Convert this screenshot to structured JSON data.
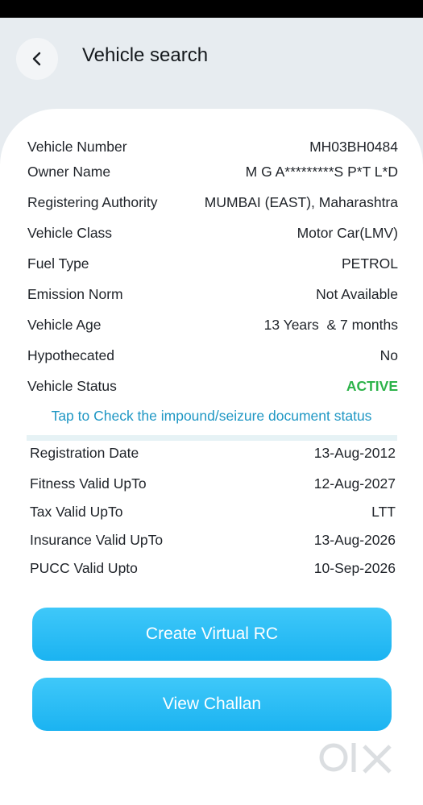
{
  "header": {
    "title": "Vehicle search"
  },
  "details": [
    {
      "label": "Vehicle Number",
      "value": "MH03BH0484"
    },
    {
      "label": "Owner Name",
      "value": "M G A*********S P*T L*D"
    },
    {
      "label": "Registering Authority",
      "value": "MUMBAI (EAST), Maharashtra"
    },
    {
      "label": "Vehicle Class",
      "value": "Motor Car(LMV)"
    },
    {
      "label": "Fuel Type",
      "value": "PETROL"
    },
    {
      "label": "Emission Norm",
      "value": "Not Available"
    },
    {
      "label": "Vehicle Age",
      "value": "13 Years  & 7 months"
    },
    {
      "label": "Hypothecated",
      "value": "No"
    },
    {
      "label": "Vehicle Status",
      "value": "ACTIVE"
    }
  ],
  "impound_link": "Tap to Check the impound/seizure document status",
  "validity": [
    {
      "label": "Registration Date",
      "value": "13-Aug-2012"
    },
    {
      "label": "Fitness Valid UpTo",
      "value": "12-Aug-2027"
    },
    {
      "label": "Tax Valid UpTo",
      "value": "LTT"
    },
    {
      "label": "Insurance Valid UpTo",
      "value": "13-Aug-2026"
    },
    {
      "label": "PUCC Valid Upto",
      "value": "10-Sep-2026"
    }
  ],
  "buttons": {
    "create_rc": "Create Virtual RC",
    "view_challan": "View Challan"
  },
  "colors": {
    "accent": "#1bb3f1",
    "link": "#1f97c4",
    "status_active": "#2db34a",
    "background": "#e7ecf0"
  },
  "icons": {
    "back": "chevron-left-icon",
    "watermark": "olx-logo"
  }
}
